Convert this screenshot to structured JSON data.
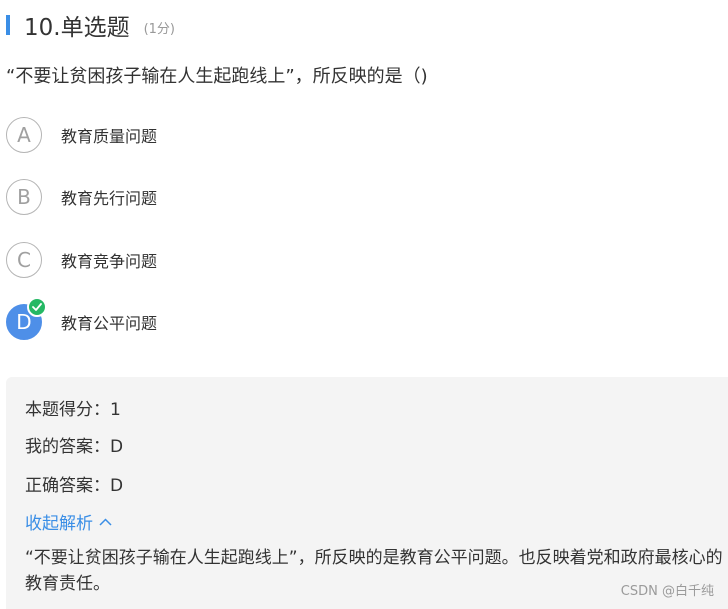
{
  "question": {
    "title": "10.单选题",
    "score": "(1分)",
    "text": "“不要让贫困孩子输在人生起跑线上”，所反映的是（)"
  },
  "options": [
    {
      "letter": "A",
      "text": "教育质量问题",
      "selected": false
    },
    {
      "letter": "B",
      "text": "教育先行问题",
      "selected": false
    },
    {
      "letter": "C",
      "text": "教育竞争问题",
      "selected": false
    },
    {
      "letter": "D",
      "text": "教育公平问题",
      "selected": true
    }
  ],
  "analysis": {
    "score_line": "本题得分：1",
    "my_answer": "我的答案：D",
    "correct_answer": "正确答案：D",
    "collapse_label": "收起解析",
    "explanation": "“不要让贫困孩子输在人生起跑线上”，所反映的是教育公平问题。也反映着党和政府最核心的教育责任。"
  },
  "watermark": "CSDN @白千纯",
  "colors": {
    "accent": "#3a8ee6",
    "selected": "#4e8fe8",
    "correct": "#25b864"
  }
}
